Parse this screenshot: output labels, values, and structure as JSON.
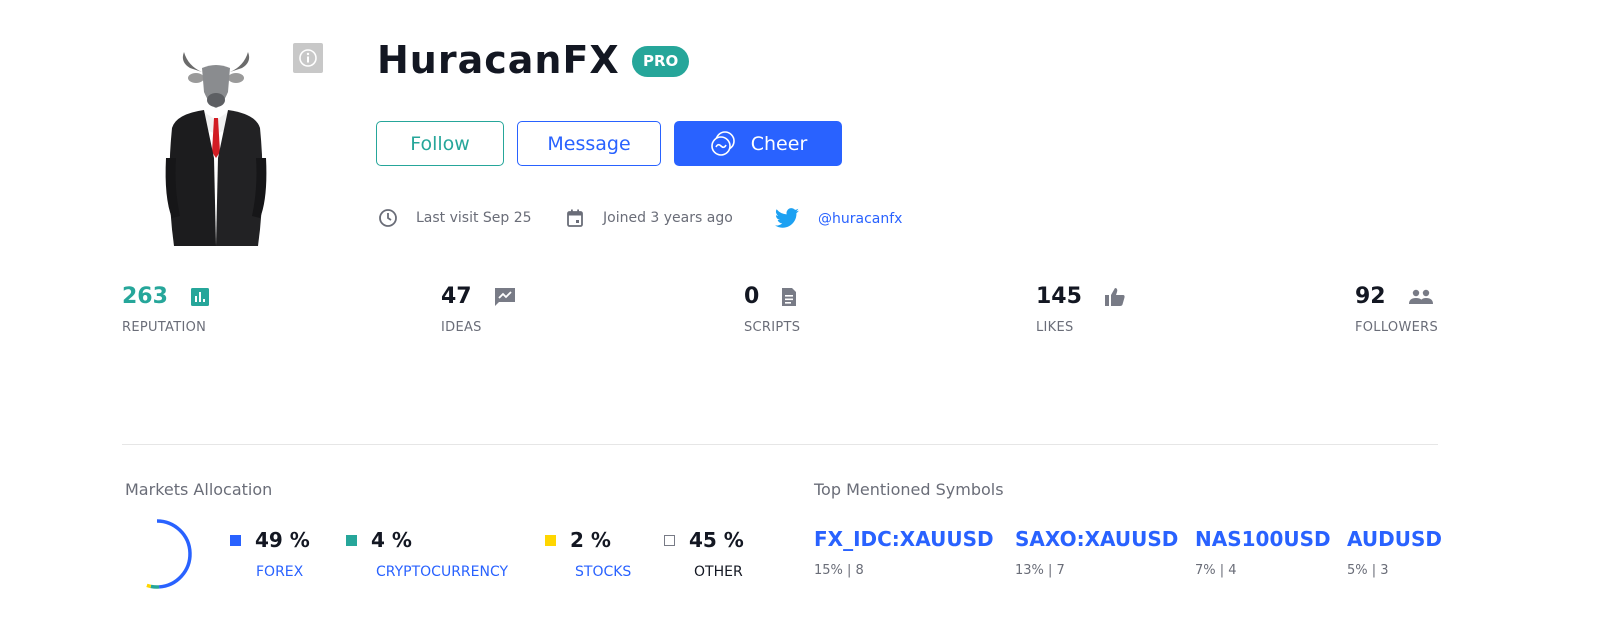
{
  "profile": {
    "username": "HuracanFX",
    "badge": "PRO",
    "avatar_alt": "bull-headed businessman in black suit with red tie",
    "buttons": {
      "follow": "Follow",
      "message": "Message",
      "cheer": "Cheer"
    },
    "meta": {
      "last_visit": "Last visit Sep 25",
      "joined": "Joined 3 years ago",
      "twitter": "@huracanfx"
    }
  },
  "stats": [
    {
      "value": "263",
      "label": "REPUTATION",
      "icon": "bar-chart-icon"
    },
    {
      "value": "47",
      "label": "IDEAS",
      "icon": "ideas-chart-icon"
    },
    {
      "value": "0",
      "label": "SCRIPTS",
      "icon": "document-icon"
    },
    {
      "value": "145",
      "label": "LIKES",
      "icon": "thumbs-up-icon"
    },
    {
      "value": "92",
      "label": "FOLLOWERS",
      "icon": "people-icon"
    }
  ],
  "markets_allocation": {
    "title": "Markets Allocation",
    "items": [
      {
        "pct_text": "49 %",
        "label": "FOREX",
        "color": "#2962ff"
      },
      {
        "pct_text": "4 %",
        "label": "CRYPTOCURRENCY",
        "color": "#26a69a"
      },
      {
        "pct_text": "2 %",
        "label": "STOCKS",
        "color": "#ffd600"
      },
      {
        "pct_text": "45 %",
        "label": "OTHER",
        "color": "#ffffff"
      }
    ]
  },
  "chart_data": {
    "type": "pie",
    "title": "Markets Allocation",
    "categories": [
      "FOREX",
      "CRYPTOCURRENCY",
      "STOCKS",
      "OTHER"
    ],
    "values": [
      49,
      4,
      2,
      45
    ],
    "colors": [
      "#2962ff",
      "#26a69a",
      "#ffd600",
      "#ffffff"
    ],
    "legend": "right"
  },
  "top_symbols": {
    "title": "Top Mentioned Symbols",
    "items": [
      {
        "symbol": "FX_IDC:XAUUSD",
        "stat": "15% | 8"
      },
      {
        "symbol": "SAXO:XAUUSD",
        "stat": "13% | 7"
      },
      {
        "symbol": "NAS100USD",
        "stat": "7% | 4"
      },
      {
        "symbol": "AUDUSD",
        "stat": "5% | 3"
      }
    ]
  }
}
